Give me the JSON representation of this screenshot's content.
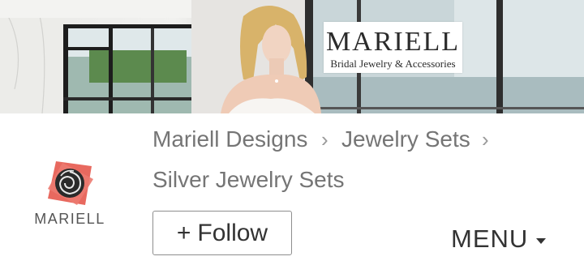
{
  "banner": {
    "brand": "MARIELL",
    "tagline": "Bridal Jewelry & Accessories"
  },
  "store": {
    "logo_text": "MARIELL",
    "logo_colors": {
      "petal": "#e8695f",
      "rose": "#2a2a2a"
    }
  },
  "breadcrumb": {
    "items": [
      "Mariell Designs",
      "Jewelry Sets",
      "Silver Jewelry Sets"
    ],
    "separator_icon": "chevron-right-icon"
  },
  "actions": {
    "follow_plus": "+",
    "follow_label": "Follow",
    "menu_label": "MENU",
    "menu_icon": "caret-down-icon"
  }
}
